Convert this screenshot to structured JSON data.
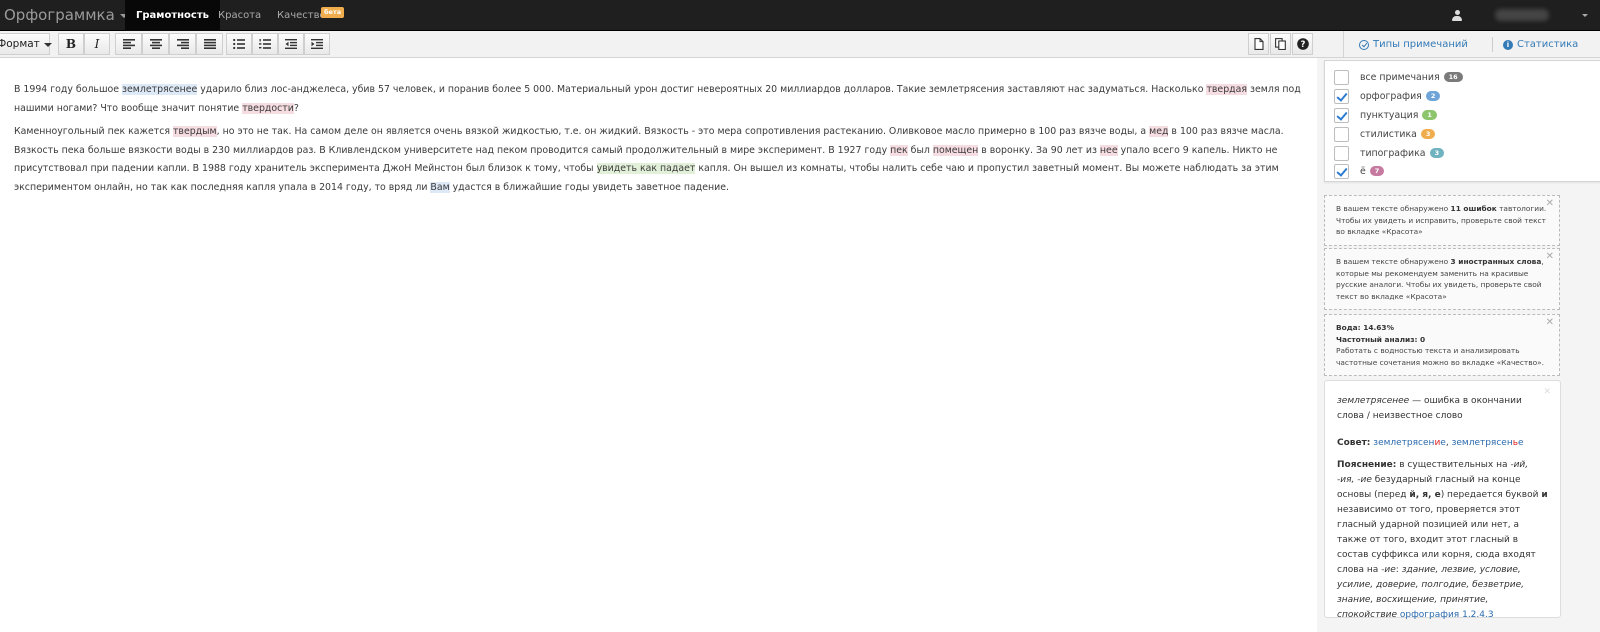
{
  "navbar": {
    "brand": "Орфограммка",
    "tabs": [
      {
        "label": "Грамотность",
        "active": true
      },
      {
        "label": "Красота",
        "active": false
      },
      {
        "label": "Качество",
        "badge": "бета",
        "active": false
      }
    ]
  },
  "toolbar": {
    "format_label": "Формат",
    "buttons": [
      "bold-icon",
      "italic-icon",
      "align-left-icon",
      "align-center-icon",
      "align-right-icon",
      "align-justify-icon",
      "bullet-list-icon",
      "numbered-list-icon",
      "outdent-icon",
      "indent-icon",
      "new-document-icon",
      "copy-icon",
      "help-icon"
    ]
  },
  "sidebar_header": {
    "types_label": "Типы примечаний",
    "stats_label": "Статистика"
  },
  "editor": {
    "p1": {
      "s1": "В 1994 году большое ",
      "w1": "землетрясенее",
      "s2": " ударило близ лос-анджелеса, убив 57 человек, и поранив более 5 000. Материальный урон достиг невероятных 20 миллиардов долларов. Такие землетрясения заставляют нас задуматься. Насколько ",
      "w2": "твердая",
      "s3": " земля под нашими ногами? Что вообще значит понятие ",
      "w3": "твердости",
      "s4": "?"
    },
    "p2": {
      "s1": "Каменноугольный пек кажется ",
      "w1": "твердым",
      "s2": ", но это не так. На самом деле он является очень вязкой жидкостью, т.е. он жидкий. Вязкость - это мера сопротивления растеканию. Оливковое масло примерно в 100 раз вязче воды, а ",
      "w2": "мед",
      "s3": " в 100 раз вязче масла. Вязкость пека больше вязкости воды в 230 миллиардов раз. В Кливлендском университете над пеком проводится самый продолжительный в мире эксперимент. В 1927 году ",
      "w3": "пек",
      "s4": " был ",
      "w4": "помещен",
      "s5": " в воронку. За 90 лет из ",
      "w5": "нее",
      "s6": " упало всего 9 капель. Никто не присутствовал при падении капли. В 1988 году хранитель эксперимента ДжоН Мейнстон был близок к тому, чтобы ",
      "w6": "увидеть как падает",
      "s7": " капля. Он вышел из комнаты, чтобы налить себе чаю и пропустил заветный момент. Вы можете наблюдать за этим экспериментом онлайн, но так как последняя капля упала в 2014 году, то вряд ли ",
      "w7": "Вам",
      "s8": " удастся в ближайшие годы увидеть заветное падение."
    }
  },
  "filters": [
    {
      "label": "все примечания",
      "count": "16",
      "color": "#7a7a7a",
      "checked": false
    },
    {
      "label": "орфография",
      "count": "2",
      "color": "#6fa4d8",
      "checked": true
    },
    {
      "label": "пунктуация",
      "count": "1",
      "color": "#8cc56b",
      "checked": true
    },
    {
      "label": "стилистика",
      "count": "3",
      "color": "#f0ad4e",
      "checked": false
    },
    {
      "label": "типографика",
      "count": "3",
      "color": "#6fb3c0",
      "checked": false
    },
    {
      "label": "ё",
      "count": "7",
      "color": "#c77aa0",
      "checked": true
    }
  ],
  "notices": {
    "n1": {
      "pre": "В вашем тексте обнаружено ",
      "bold": "11 ошибок",
      "post": " тавтологии. Чтобы их увидеть и исправить, проверьте свой текст во вкладке «Красота»"
    },
    "n2": {
      "pre": "В вашем тексте обнаружено ",
      "bold": "3 иностранных слова",
      "post": ", которые мы рекомендуем заменить на красивые русские аналоги. Чтобы их увидеть, проверьте свой текст во вкладке «Красота»"
    },
    "n3": {
      "water": "Вода: 14.63%",
      "freq": "Частотный анализ: 0",
      "text": "Работать с водностью текста и анализировать частотные сочетания можно во вкладке «Качество»."
    }
  },
  "explanation": {
    "word": "землетрясенее",
    "desc": " — ошибка в окончании слова / неизвестное слово",
    "advice_label": "Совет:",
    "advice_1a": "землетрясен",
    "advice_1b": "и",
    "advice_1c": "е",
    "advice_sep": ", ",
    "advice_2a": "землетрясен",
    "advice_2b": "ь",
    "advice_2c": "е",
    "rule_label": "Пояснение:",
    "rule_1": " в существительных на ",
    "rule_endings": "-ий, -ия, -ие",
    "rule_2": " безударный гласный на конце основы (перед ",
    "rule_letters": "й, я, е",
    "rule_3": ") передается буквой ",
    "rule_i": "и",
    "rule_4": " независимо от того, проверяется этот гласный ударной позицией или нет, а также от того, входит этот гласный в состав суффикса или корня, сюда входят слова на ",
    "rule_ie": "-ие",
    "rule_5": ": ",
    "rule_examples": "здание, лезвие, условие, усилие, доверие, полгодие, безветрие, знание, восхищение, принятие, спокойствие",
    "rule_link": "орфография 1.2.4.3"
  }
}
